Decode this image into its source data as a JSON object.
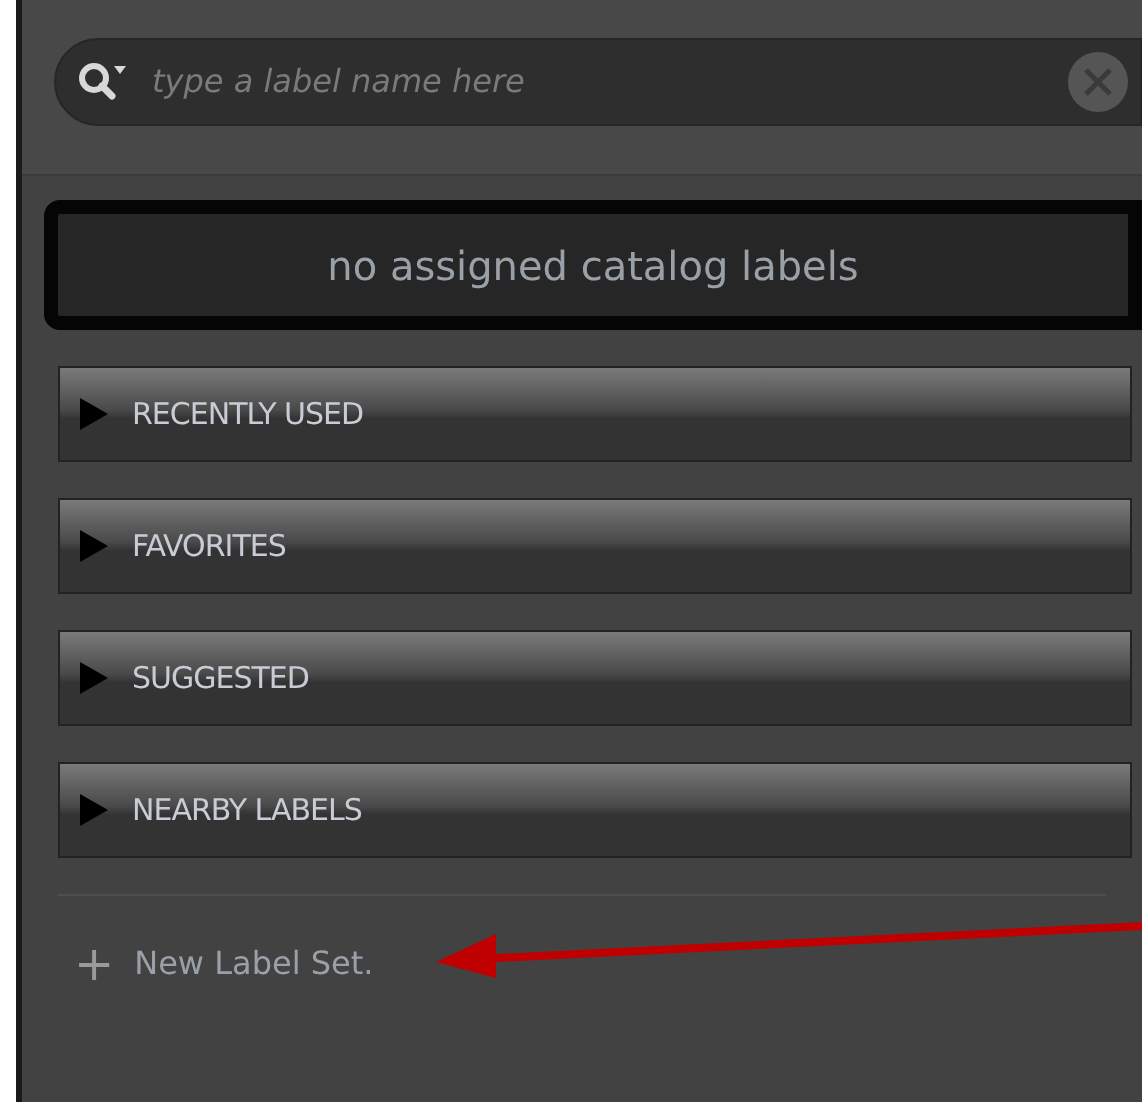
{
  "search": {
    "placeholder": "type a label name here"
  },
  "assigned_labels": {
    "empty_text": "no assigned catalog labels"
  },
  "sections": [
    {
      "label": "RECENTLY USED",
      "expanded": false
    },
    {
      "label": "FAVORITES",
      "expanded": false
    },
    {
      "label": "SUGGESTED",
      "expanded": false
    },
    {
      "label": "NEARBY LABELS",
      "expanded": false
    }
  ],
  "new_label_set": {
    "icon": "+",
    "label": "New Label Set."
  }
}
